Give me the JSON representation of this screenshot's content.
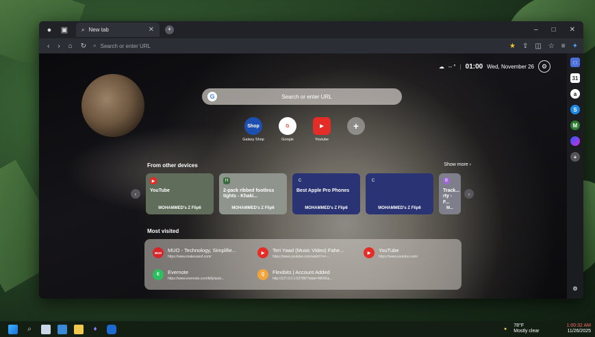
{
  "browser": {
    "tab_title": "New tab",
    "address_placeholder": "Search or enter URL",
    "window_controls": [
      "–",
      "□",
      "✕"
    ]
  },
  "header_widget": {
    "weather_text": "-- °",
    "time": "01:00",
    "date": "Wed, November 26"
  },
  "search": {
    "placeholder": "Search or enter URL"
  },
  "shortcuts": [
    {
      "label": "Galaxy Shop",
      "icon_text": "Shop",
      "color": "#1d4fb0"
    },
    {
      "label": "Google",
      "icon_text": "G",
      "color": "#ffffff"
    },
    {
      "label": "Youtube",
      "icon_text": "▶",
      "color": "#e52d27"
    }
  ],
  "other_devices": {
    "title": "From other devices",
    "show_more": "Show more",
    "cards": [
      {
        "badge": "▶",
        "title": "YouTube",
        "device": "MOHAMMED's Z Flip6",
        "bg": "#5f6d5a",
        "badge_color": "#e52d27"
      },
      {
        "badge": "H",
        "title": "2-pack ribbed footless tights - Khaki...",
        "device": "MOHAMMED's Z Flip6",
        "bg": "#8f948d",
        "badge_color": "#3d6b3d"
      },
      {
        "badge": "C",
        "title": "Best Apple Pro Phones",
        "device": "MOHAMMED's Z Flip6",
        "bg": "#2a3475",
        "badge_color": "#2a3475"
      },
      {
        "badge": "C",
        "title": "",
        "device": "MOHAMMED's Z Flip6",
        "bg": "#2a3475",
        "badge_color": "#2a3475"
      },
      {
        "badge": "B",
        "title": "Track... rty - F...",
        "device": "M...",
        "bg": "#7e7f8a",
        "badge_color": "#9a6ad0"
      }
    ]
  },
  "most_visited": {
    "title": "Most visited",
    "items": [
      {
        "title": "MUO - Technology, Simplifie...",
        "url": "https://www.makeuseof.com/",
        "icon": "MUO",
        "color": "#d7262b"
      },
      {
        "title": "Teri Yaad (Music Video) Fahe...",
        "url": "https://www.youtube.com/watch?v=-...",
        "icon": "▶",
        "color": "#e52d27"
      },
      {
        "title": "YouTube",
        "url": "https://www.youtube.com/",
        "icon": "▶",
        "color": "#e52d27"
      },
      {
        "title": "Evernote",
        "url": "https://www.evernote.com/billy/auto...",
        "icon": "E",
        "color": "#2dbe60"
      },
      {
        "title": "Flexibits | Account Added",
        "url": "http://127.0.0.1:52786/?state=NKDEp...",
        "icon": "Q",
        "color": "#f2a33a"
      }
    ]
  },
  "sidebar": [
    "□",
    "31",
    "a",
    "S",
    "M",
    "●",
    "+"
  ],
  "taskbar": {
    "weather_temp": "78°F",
    "weather_desc": "Mostly clear",
    "time": "1:00:32 AM",
    "date": "11/26/2025"
  }
}
